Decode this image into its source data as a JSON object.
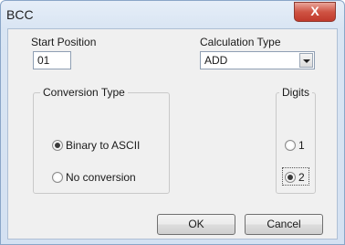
{
  "window": {
    "title": "BCC",
    "close_label": "X"
  },
  "start_position": {
    "label": "Start Position",
    "value": "01"
  },
  "calculation_type": {
    "label": "Calculation Type",
    "value": "ADD"
  },
  "conversion_type": {
    "title": "Conversion Type",
    "options": [
      "Binary to ASCII",
      "No conversion"
    ],
    "selected": "Binary to ASCII"
  },
  "digits": {
    "title": "Digits",
    "options": [
      "1",
      "2"
    ],
    "selected": "2"
  },
  "buttons": {
    "ok": "OK",
    "cancel": "Cancel"
  }
}
